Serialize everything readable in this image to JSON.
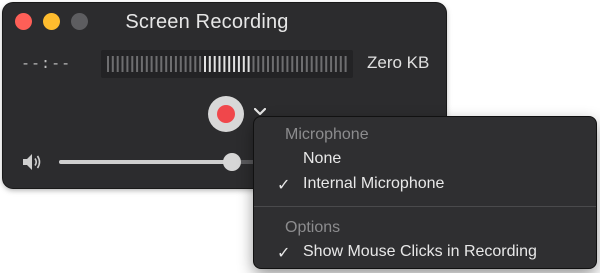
{
  "window": {
    "title": "Screen Recording",
    "time": "--:--",
    "file_size": "Zero KB"
  },
  "volume": {
    "level": 0.72
  },
  "menu": {
    "microphone_header": "Microphone",
    "microphone_items": [
      {
        "label": "None",
        "checked": false
      },
      {
        "label": "Internal Microphone",
        "checked": true
      }
    ],
    "options_header": "Options",
    "option_items": [
      {
        "label": "Show Mouse Clicks in Recording",
        "checked": true
      }
    ],
    "check_glyph": "✓"
  },
  "colors": {
    "record": "#f0474b",
    "close": "#fe5f57",
    "minimize": "#febc2e"
  }
}
